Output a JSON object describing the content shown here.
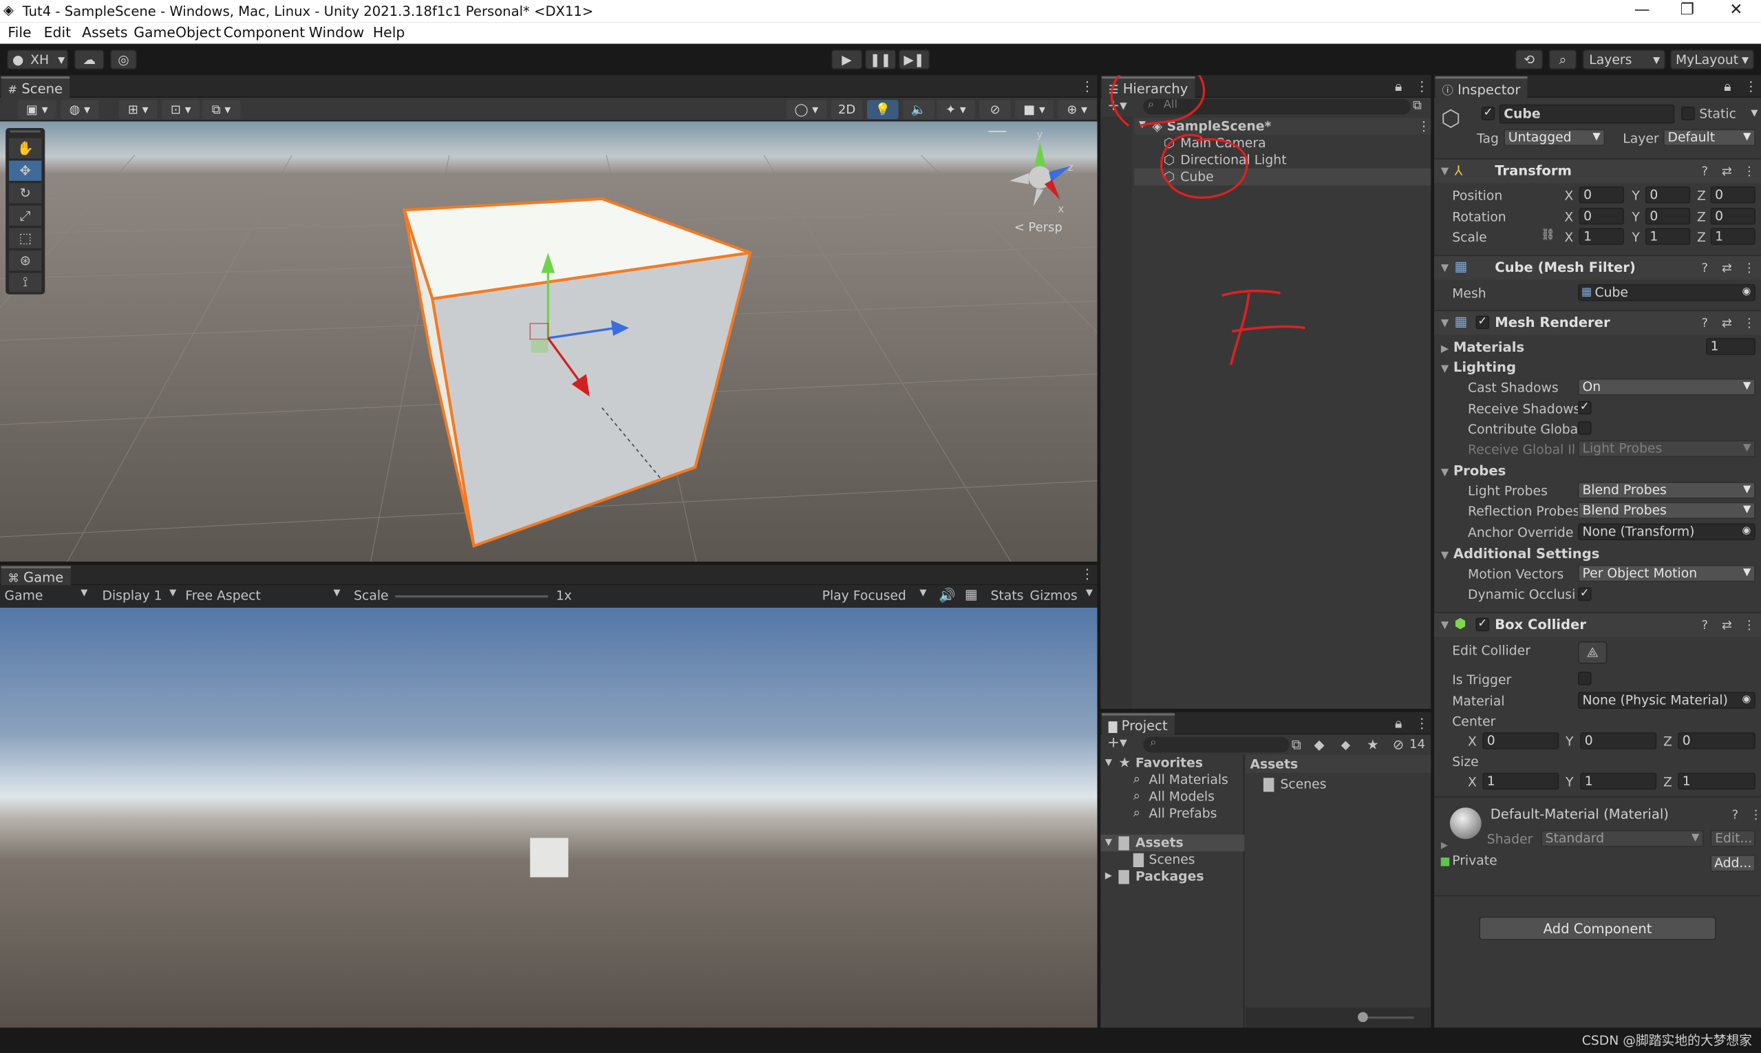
{
  "window": {
    "title": "Tut4 - SampleScene - Windows, Mac, Linux - Unity 2021.3.18f1c1 Personal* <DX11>",
    "minimize": "—",
    "maximize": "❐",
    "close": "✕"
  },
  "menu": [
    "File",
    "Edit",
    "Assets",
    "GameObject",
    "Component",
    "Window",
    "Help"
  ],
  "toolbar": {
    "account": "XH",
    "layers": "Layers",
    "layout": "MyLayout"
  },
  "scene": {
    "tab": "Scene",
    "mode2d": "2D",
    "persp": "< Persp",
    "gizmo": {
      "x": "x",
      "y": "y",
      "z": "z"
    }
  },
  "game": {
    "tab": "Game",
    "display_mode": "Game",
    "display": "Display 1",
    "aspect": "Free Aspect",
    "scale_label": "Scale",
    "scale_value": "1x",
    "play_mode": "Play Focused",
    "stats": "Stats",
    "gizmos": "Gizmos"
  },
  "hierarchy": {
    "tab": "Hierarchy",
    "search_placeholder": "All",
    "scene": "SampleScene*",
    "items": [
      "Main Camera",
      "Directional Light",
      "Cube"
    ]
  },
  "annotation": {
    "letter": "F"
  },
  "project": {
    "tab": "Project",
    "badge": "14",
    "favorites": "Favorites",
    "fav_items": [
      "All Materials",
      "All Models",
      "All Prefabs"
    ],
    "assets": "Assets",
    "assets_child": "Scenes",
    "packages": "Packages",
    "right_header": "Assets",
    "right_items": [
      "Scenes"
    ]
  },
  "inspector": {
    "tab": "Inspector",
    "object_name": "Cube",
    "static_label": "Static",
    "tag_label": "Tag",
    "tag_value": "Untagged",
    "layer_label": "Layer",
    "layer_value": "Default",
    "transform": {
      "name": "Transform",
      "rows": [
        {
          "label": "Position",
          "x": "0",
          "y": "0",
          "z": "0"
        },
        {
          "label": "Rotation",
          "x": "0",
          "y": "0",
          "z": "0"
        },
        {
          "label": "Scale",
          "x": "1",
          "y": "1",
          "z": "1"
        }
      ]
    },
    "axis": {
      "x": "X",
      "y": "Y",
      "z": "Z"
    },
    "mesh_filter": {
      "name": "Cube (Mesh Filter)",
      "mesh_label": "Mesh",
      "mesh_value": "Cube"
    },
    "mesh_renderer": {
      "name": "Mesh Renderer",
      "materials_label": "Materials",
      "materials_count": "1",
      "lighting": "Lighting",
      "cast_shadows_label": "Cast Shadows",
      "cast_shadows": "On",
      "receive_shadows": "Receive Shadows",
      "contribute_global": "Contribute Global",
      "receive_gi_label": "Receive Global Illu",
      "receive_gi": "Light Probes",
      "probes": "Probes",
      "light_probes_label": "Light Probes",
      "light_probes": "Blend Probes",
      "reflection_label": "Reflection Probes",
      "reflection": "Blend Probes",
      "anchor_label": "Anchor Override",
      "anchor": "None (Transform)",
      "additional": "Additional Settings",
      "motion_label": "Motion Vectors",
      "motion": "Per Object Motion",
      "dynamic_occlusion": "Dynamic Occlusion"
    },
    "box_collider": {
      "name": "Box Collider",
      "edit_label": "Edit Collider",
      "trigger_label": "Is Trigger",
      "material_label": "Material",
      "material_value": "None (Physic Material)",
      "center_label": "Center",
      "center": {
        "x": "0",
        "y": "0",
        "z": "0"
      },
      "size_label": "Size",
      "size": {
        "x": "1",
        "y": "1",
        "z": "1"
      }
    },
    "material": {
      "name": "Default-Material (Material)",
      "shader_label": "Shader",
      "shader": "Standard",
      "edit": "Edit...",
      "private": "Private",
      "add": "Add..."
    },
    "add_component": "Add Component"
  },
  "status": {
    "watermark": "CSDN @脚踏实地的大梦想家"
  },
  "colors": {
    "accent_blue": "#3a79bb",
    "selection_orange": "#f47a22",
    "annotation_red": "#e02020"
  }
}
